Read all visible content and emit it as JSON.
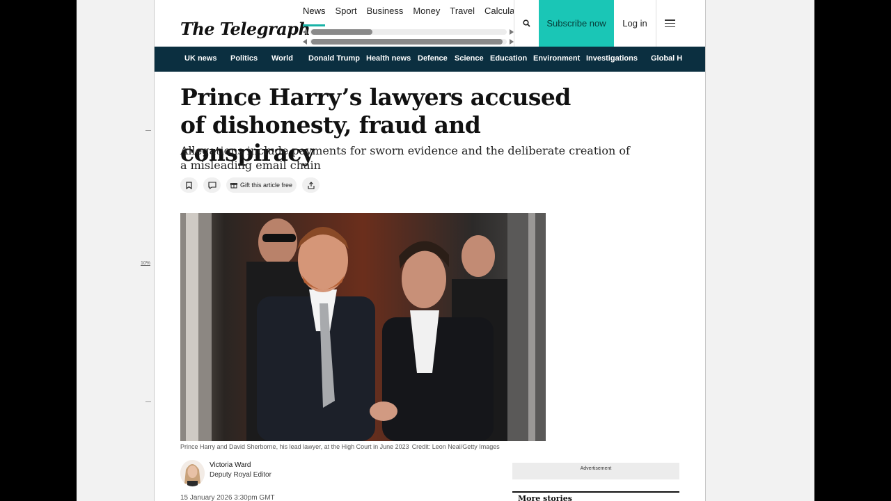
{
  "document": {
    "zoom_label": "10%"
  },
  "header": {
    "logo": "The Telegraph",
    "topnav": [
      "News",
      "Sport",
      "Business",
      "Money",
      "Travel",
      "Calculato"
    ],
    "subscribe_label": "Subscribe now",
    "login_label": "Log in"
  },
  "section_nav": [
    "UK news",
    "Politics",
    "World",
    "Donald Trump",
    "Health news",
    "Defence",
    "Science",
    "Education",
    "Environment",
    "Investigations",
    "Global H"
  ],
  "article": {
    "headline": "Prince Harry’s lawyers accused of dishonesty, fraud and conspiracy",
    "standfirst": "Allegations include payments for sworn evidence and the deliberate creation of a misleading email chain",
    "gift_label": "Gift this article free",
    "caption": "Prince Harry and David Sherborne, his lead lawyer, at the High Court in June 2023",
    "credit": "Credit: Leon Neal/Getty Images",
    "author_name": "Victoria Ward",
    "author_role": "Deputy Royal Editor",
    "date": "15 January 2026 3:30pm GMT"
  },
  "sidebar": {
    "advert_label": "Advertisement",
    "more_stories": "More stories"
  },
  "colors": {
    "subscribe": "#1ac6b6",
    "section_nav_bg": "#0b2f40",
    "accent_underline": "#19b3a7"
  }
}
